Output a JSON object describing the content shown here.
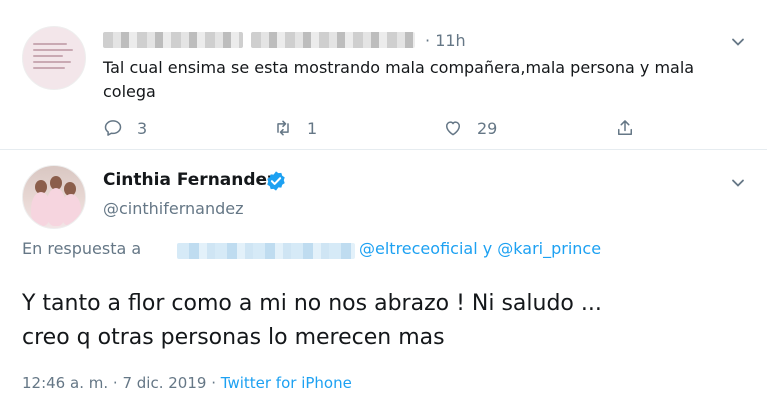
{
  "reply_tweet": {
    "timestamp": "11h",
    "separator": "·",
    "text": "Tal cual ensima se esta mostrando mala compañera,mala persona y mala colega",
    "actions": {
      "reply_count": "3",
      "retweet_count": "1",
      "like_count": "29"
    }
  },
  "main_tweet": {
    "author_name": "Cinthia Fernandez",
    "handle": "@cinthifernandez",
    "reply_prefix": "En respuesta a",
    "reply_mentions": "@eltreceoficial y @kari_prince",
    "text_line1": "Y tanto a flor como a mi no nos abrazo ! Ni saludo ...",
    "text_line2": "creo q otras personas lo merecen mas",
    "time": "12:46 a. m.",
    "date": "7 dic. 2019",
    "source": "Twitter for iPhone",
    "sep": "·"
  },
  "colors": {
    "link": "#1da1f2",
    "muted": "#657786",
    "text": "#14171a",
    "divider": "#e6ecf0"
  },
  "icons": [
    "chevron-down-icon",
    "reply-icon",
    "retweet-icon",
    "like-icon",
    "share-icon",
    "verified-badge-icon"
  ]
}
